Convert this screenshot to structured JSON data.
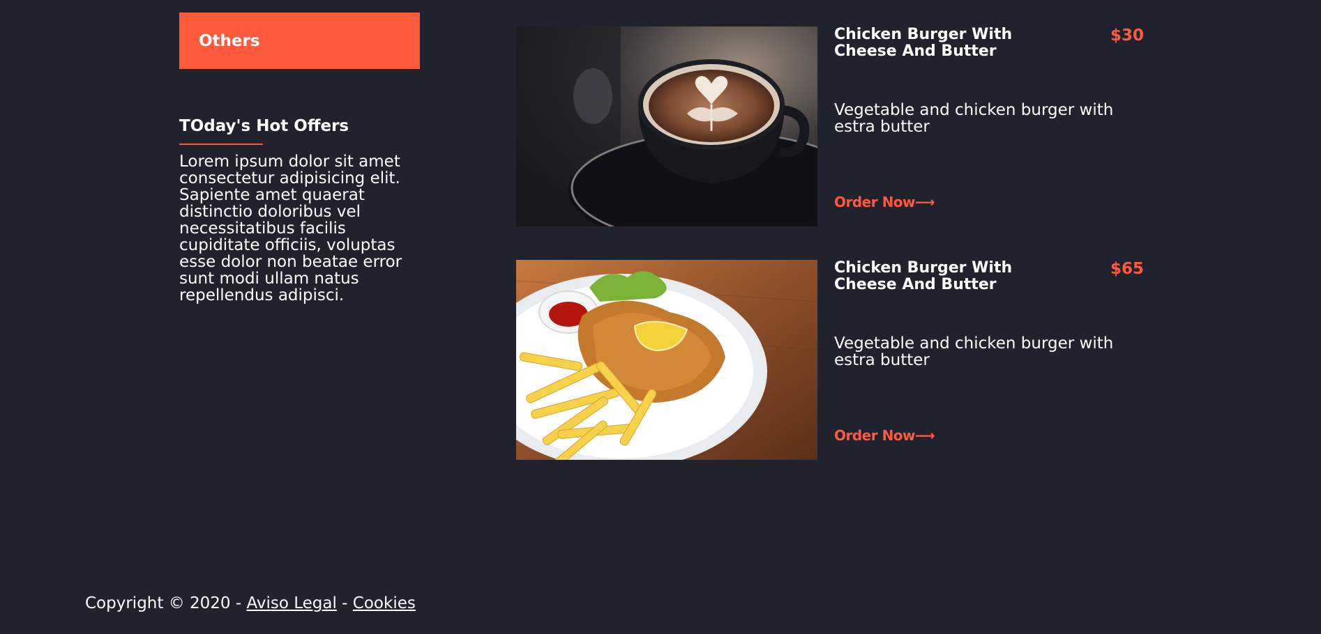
{
  "sidebar": {
    "category_label": "Others",
    "offers_title": "TOday's Hot Offers",
    "offers_text": "Lorem ipsum dolor sit amet consectetur adipisicing elit. Sapiente amet quaerat distinctio doloribus vel necessitatibus facilis cupiditate officiis, voluptas esse dolor non beatae error sunt modi ullam natus repellendus adipisci."
  },
  "menu": {
    "items": [
      {
        "name": "Chicken Burger With Cheese And Butter",
        "price": "$30",
        "description": "Vegetable and chicken burger with estra butter",
        "order_label": "Order Now⟶",
        "image": "latte-coffee-cup-photo"
      },
      {
        "name": "Chicken Burger With Cheese And Butter",
        "price": "$65",
        "description": "Vegetable and chicken burger with estra butter",
        "order_label": "Order Now⟶",
        "image": "schnitzel-with-fries-photo"
      }
    ]
  },
  "footer": {
    "copyright": "Copyright © 2020 - ",
    "legal_link": "Aviso Legal",
    "separator": " - ",
    "cookies_link": "Cookies"
  },
  "colors": {
    "background": "#20222e",
    "accent": "#ff5a3c",
    "text": "#ffffff"
  }
}
